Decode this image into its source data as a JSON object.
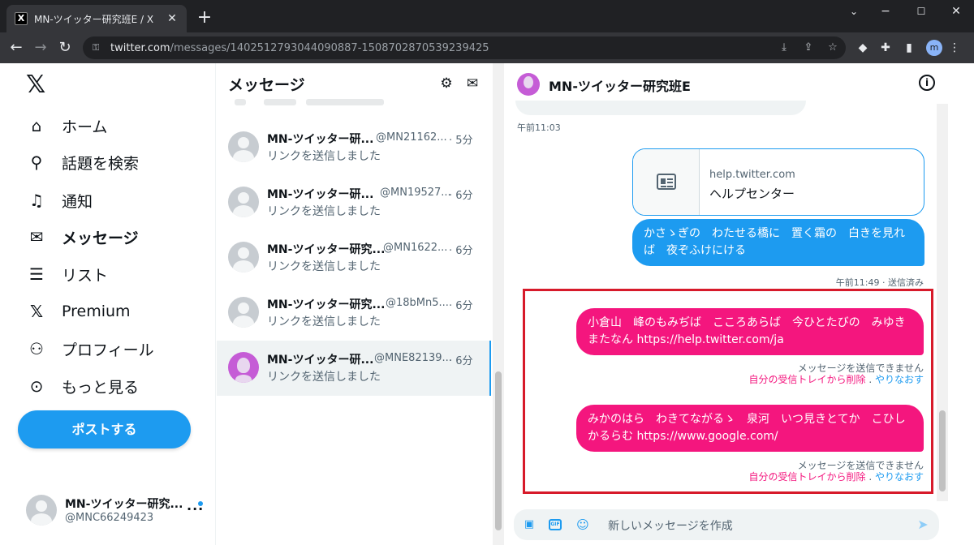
{
  "browser": {
    "tab_title": "MN-ツイッター研究班E / X",
    "tab_icon": "x-logo-favicon",
    "new_tab": "+",
    "url_host": "twitter.com",
    "url_path": "/messages/1402512793044090887-1508702870539239425",
    "profile_initial": "m",
    "win_min": "−",
    "win_max": "☐",
    "win_close": "✕",
    "chevron": "⌄"
  },
  "nav": {
    "logo": "𝕏",
    "items": [
      {
        "label": "ホーム",
        "icon": "home-icon"
      },
      {
        "label": "話題を検索",
        "icon": "search-icon"
      },
      {
        "label": "通知",
        "icon": "bell-icon"
      },
      {
        "label": "メッセージ",
        "icon": "mail-icon"
      },
      {
        "label": "リスト",
        "icon": "list-icon"
      },
      {
        "label": "Premium",
        "icon": "x-premium-icon"
      },
      {
        "label": "プロフィール",
        "icon": "person-icon"
      },
      {
        "label": "もっと見る",
        "icon": "more-circle-icon"
      }
    ],
    "post_button": "ポストする",
    "account_name": "MN-ツイッター研究...",
    "account_handle": "@MNC66249423",
    "account_more": "···"
  },
  "messages": {
    "title": "メッセージ",
    "conversations": [
      {
        "name": "MN-ツイッター研...",
        "handle": "@MN21162...",
        "time": "· 5分",
        "preview": "リンクを送信しました"
      },
      {
        "name": "MN-ツイッター研...",
        "handle": "@MN19527...",
        "time": "· 6分",
        "preview": "リンクを送信しました"
      },
      {
        "name": "MN-ツイッター研究...",
        "handle": "@MN1622...",
        "time": "· 6分",
        "preview": "リンクを送信しました"
      },
      {
        "name": "MN-ツイッター研究...",
        "handle": "@18bMn5...",
        "time": "· 6分",
        "preview": "リンクを送信しました"
      },
      {
        "name": "MN-ツイッター研...",
        "handle": "@MNE82139...",
        "time": "· 6分",
        "preview": "リンクを送信しました"
      }
    ]
  },
  "conversation": {
    "title": "MN-ツイッター研究班E",
    "timestamp_1": "午前11:03",
    "card_domain": "help.twitter.com",
    "card_title": "ヘルプセンター",
    "msg_1": "かさゝぎの　わたせる橋に　置く霜の　白きを見れば　夜ぞふけにける",
    "timestamp_2": "午前11:49 · 送信済み",
    "msg_2": "小倉山　峰のもみぢば　こころあらば　今ひとたびの　みゆきまたなん https://help.twitter.com/ja",
    "msg_3": "みかのはら　わきてながるゝ　泉河　いつ見きとてか　こひしかるらむ https://www.google.com/",
    "error_text": "メッセージを送信できません",
    "error_delete": "自分の受信トレイから削除",
    "error_sep": " . ",
    "error_retry": "やりなおす",
    "composer_placeholder": "新しいメッセージを作成"
  },
  "colors": {
    "accent": "#1d9bf0",
    "failed_bubble": "#f4167e",
    "highlight_box": "#d71a2a"
  }
}
